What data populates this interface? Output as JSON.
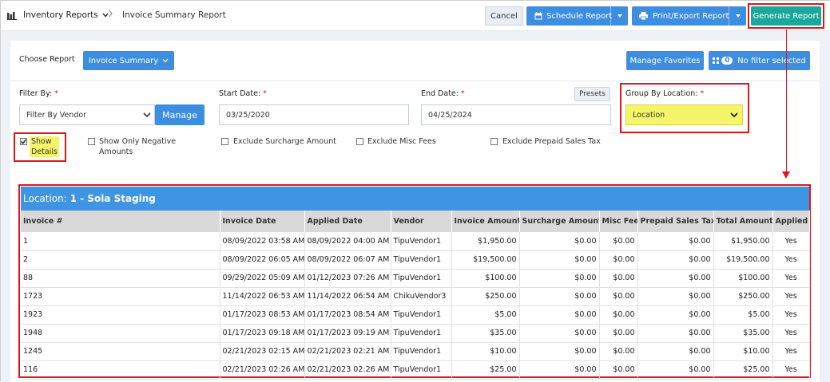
{
  "breadcrumb": {
    "parent": "Inventory Reports",
    "current": "Invoice Summary Report"
  },
  "toolbar": {
    "cancel": "Cancel",
    "schedule": "Schedule Report",
    "print": "Print/Export Report",
    "generate": "Generate Report"
  },
  "report": {
    "choose_label": "Choose Report",
    "selected": "Invoice Summary",
    "manage_favorites": "Manage Favorites",
    "filter_count": "0",
    "no_filter": "No filter selected"
  },
  "filters": {
    "filter_by_label": "Filter By:",
    "filter_by_value": "Filter By Vendor",
    "manage": "Manage",
    "start_label": "Start Date:",
    "start_value": "03/25/2020",
    "end_label": "End Date:",
    "end_value": "04/25/2024",
    "presets": "Presets",
    "group_label": "Group By Location:",
    "group_value": "Location",
    "required_mark": "*"
  },
  "options": {
    "show_details_1": "Show",
    "show_details_2": "Details",
    "negative_1": "Show Only Negative",
    "negative_2": "Amounts",
    "surcharge": "Exclude Surcharge Amount",
    "misc": "Exclude Misc Fees",
    "prepaid": "Exclude Prepaid Sales Tax"
  },
  "location": {
    "prefix": "Location: ",
    "name": "1 - Sola Staging"
  },
  "table": {
    "headers": [
      "Invoice #",
      "Invoice Date",
      "Applied Date",
      "Vendor",
      "Invoice Amount",
      "Surcharge Amount",
      "Misc Fee",
      "Prepaid Sales Tax",
      "Total Amount",
      "Applied"
    ],
    "rows": [
      [
        "1",
        "08/09/2022 03:58 AM",
        "08/09/2022 04:00 AM",
        "TipuVendor1",
        "$1,950.00",
        "$0.00",
        "$0.00",
        "$0.00",
        "$1,950.00",
        "Yes"
      ],
      [
        "2",
        "08/09/2022 06:05 AM",
        "08/09/2022 06:07 AM",
        "TipuVendor1",
        "$19,500.00",
        "$0.00",
        "$0.00",
        "$0.00",
        "$19,500.00",
        "Yes"
      ],
      [
        "88",
        "09/29/2022 05:09 AM",
        "01/12/2023 07:26 AM",
        "TipuVendor1",
        "$100.00",
        "$0.00",
        "$0.00",
        "$0.00",
        "$100.00",
        "Yes"
      ],
      [
        "1723",
        "11/14/2022 06:53 AM",
        "11/14/2022 06:54 AM",
        "ChikuVendor3",
        "$250.00",
        "$0.00",
        "$0.00",
        "$0.00",
        "$250.00",
        "Yes"
      ],
      [
        "1923",
        "01/17/2023 08:53 AM",
        "01/17/2023 08:54 AM",
        "TipuVendor1",
        "$5.00",
        "$0.00",
        "$0.00",
        "$0.00",
        "$5.00",
        "Yes"
      ],
      [
        "1948",
        "01/17/2023 09:18 AM",
        "01/17/2023 09:19 AM",
        "TipuVendor1",
        "$35.00",
        "$0.00",
        "$0.00",
        "$0.00",
        "$35.00",
        "Yes"
      ],
      [
        "1245",
        "02/21/2023 02:15 AM",
        "02/21/2023 02:21 AM",
        "TipuVendor1",
        "$10.00",
        "$0.00",
        "$0.00",
        "$0.00",
        "$10.00",
        "Yes"
      ],
      [
        "116",
        "02/21/2023 02:26 AM",
        "02/21/2023 02:26 AM",
        "TipuVendor1",
        "$25.00",
        "$0.00",
        "$0.00",
        "$0.00",
        "$25.00",
        "Yes"
      ]
    ]
  },
  "colors": {
    "primary": "#3d8de0",
    "generate": "#1aa89b",
    "highlight": "#f5f56b",
    "annotation": "#e0161e"
  }
}
